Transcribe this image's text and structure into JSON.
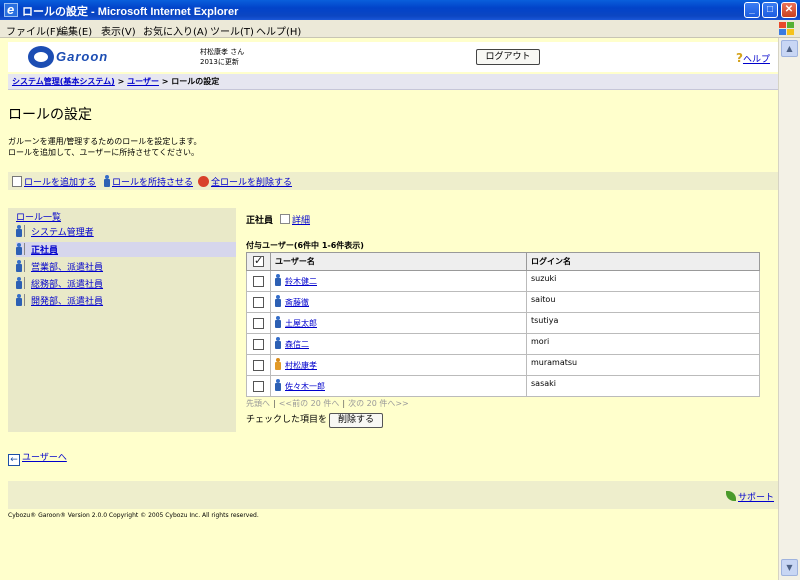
{
  "window": {
    "title": "ロールの設定 - Microsoft Internet Explorer",
    "minimize": "_",
    "maximize": "□",
    "close": "✕"
  },
  "menu": [
    "ファイル(F)",
    "編集(E)",
    "表示(V)",
    "お気に入り(A)",
    "ツール(T)",
    "ヘルプ(H)"
  ],
  "header": {
    "logo_text": "Garoon",
    "user_name": "村松康孝 さん",
    "updated": "2013に更新",
    "logout_label": "ログアウト",
    "help_label": "ヘルプ"
  },
  "breadcrumb": {
    "item1": "システム管理(基本システム)",
    "sep": ">",
    "item2": "ユーザー",
    "current": "ロールの設定"
  },
  "page": {
    "title": "ロールの設定",
    "desc1": "ガルーンを運用/管理するためのロールを設定します。",
    "desc2": "ロールを追加して、ユーザーに所持させてください。"
  },
  "toolbar": {
    "add_role": "ロールを追加する",
    "assign_role": "ロールを所持させる",
    "delete_all": "全ロールを削除する"
  },
  "role_list": {
    "header": "ロール一覧",
    "items": [
      "システム管理者",
      "正社員",
      "営業部、派遣社員",
      "総務部、派遣社員",
      "開発部、派遣社員"
    ]
  },
  "role_detail": {
    "name": "正社員",
    "detail_label": "詳細",
    "users_heading": "付与ユーザー(6件中 1-6件表示)",
    "col_user": "ユーザー名",
    "col_login": "ログイン名",
    "users": [
      {
        "name": "鈴木健二",
        "login": "suzuki"
      },
      {
        "name": "斎藤徹",
        "login": "saitou"
      },
      {
        "name": "土屋太郎",
        "login": "tsutiya"
      },
      {
        "name": "森信二",
        "login": "mori"
      },
      {
        "name": "村松康孝",
        "login": "muramatsu"
      },
      {
        "name": "佐々木一郎",
        "login": "sasaki"
      }
    ]
  },
  "pager": {
    "first": "先頭へ",
    "prev": "<<前の 20 件へ",
    "next": "次の 20 件へ>>"
  },
  "action": {
    "label": "チェックした項目を",
    "delete_label": "削除する"
  },
  "back": {
    "label": "ユーザーへ"
  },
  "footer": {
    "support_label": "サポート",
    "copyright": "Cybozu® Garoon® Version 2.0.0    Copyright © 2005 Cybozu Inc. All rights reserved."
  },
  "colors": {
    "page_bg": "#ffffcc",
    "link": "#0000cc",
    "titlebar": "#0243c9"
  }
}
